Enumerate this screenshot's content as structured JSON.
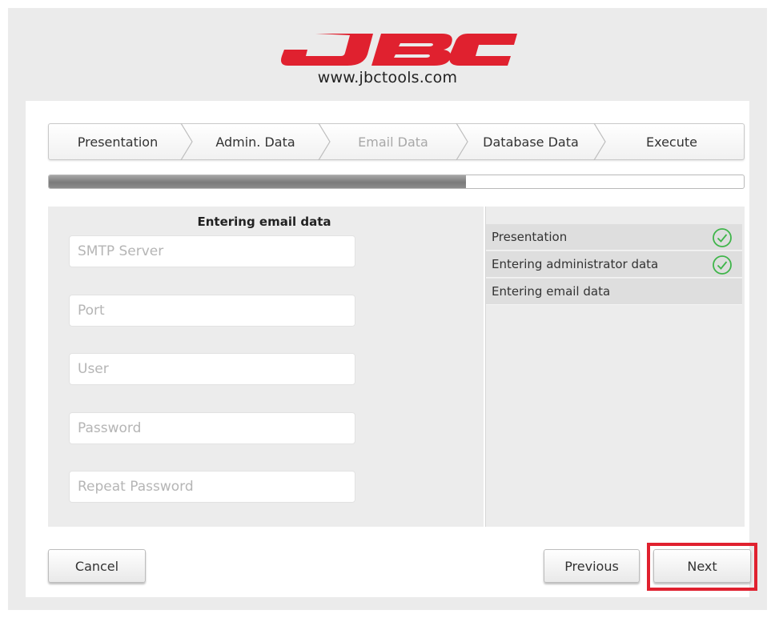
{
  "brand": {
    "logo_text": "JBC",
    "url": "www.jbctools.com",
    "logo_color": "#e0212f"
  },
  "steps": [
    {
      "label": "Presentation",
      "state": "done"
    },
    {
      "label": "Admin. Data",
      "state": "done"
    },
    {
      "label": "Email Data",
      "state": "current"
    },
    {
      "label": "Database Data",
      "state": "pending"
    },
    {
      "label": "Execute",
      "state": "pending"
    }
  ],
  "progress": {
    "fraction": 0.6
  },
  "form": {
    "title": "Entering email data",
    "fields": [
      {
        "placeholder": "SMTP Server",
        "value": ""
      },
      {
        "placeholder": "Port",
        "value": ""
      },
      {
        "placeholder": "User",
        "value": ""
      },
      {
        "placeholder": "Password",
        "value": ""
      },
      {
        "placeholder": "Repeat Password",
        "value": ""
      }
    ]
  },
  "checklist": [
    {
      "label": "Presentation",
      "done": true,
      "icon": "check-circle-icon"
    },
    {
      "label": "Entering administrator data",
      "done": true,
      "icon": "check-circle-icon"
    },
    {
      "label": "Entering email data",
      "done": false
    }
  ],
  "buttons": {
    "cancel": "Cancel",
    "previous": "Previous",
    "next": "Next"
  },
  "colors": {
    "check_green": "#3fb54a",
    "highlight_red": "#e0212f"
  }
}
